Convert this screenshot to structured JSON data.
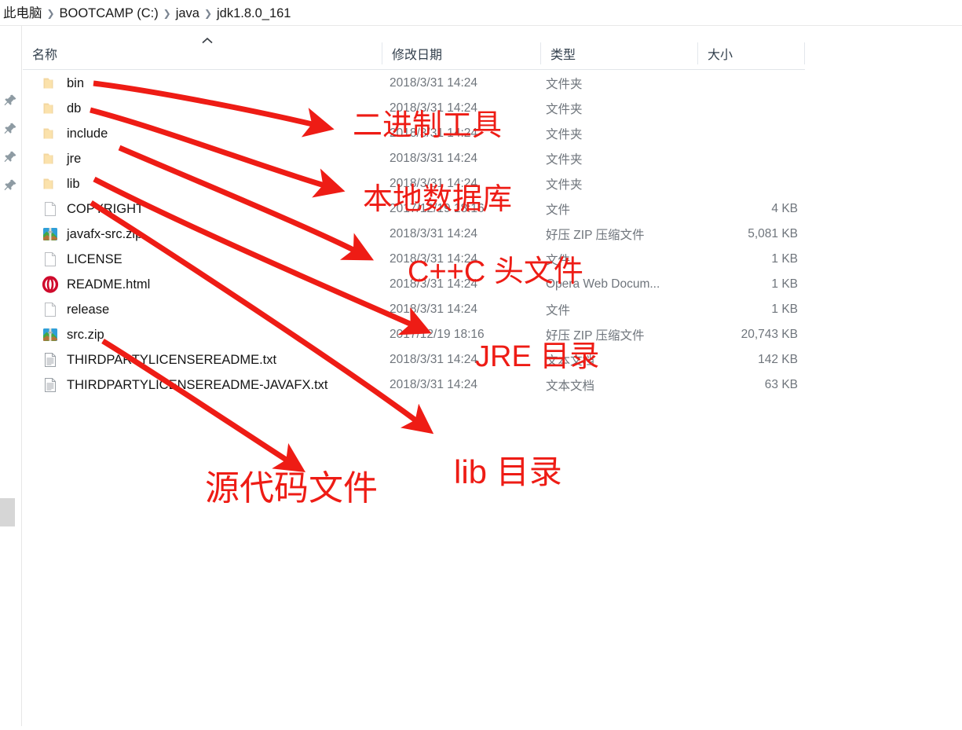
{
  "breadcrumb": {
    "separator": "❯",
    "items": [
      "此电脑",
      "BOOTCAMP (C:)",
      "java",
      "jdk1.8.0_161"
    ]
  },
  "nav_rail": {
    "pin_icon": "pin-icon",
    "pin_count": 4,
    "scrollbar": "vertical-scrollbar-thumb"
  },
  "columns": {
    "name": "名称",
    "date": "修改日期",
    "type": "类型",
    "size": "大小",
    "sort_indicator": "chevron-up-icon"
  },
  "files": [
    {
      "name": "bin",
      "icon": "folder-icon",
      "date": "2018/3/31 14:24",
      "type": "文件夹",
      "size": ""
    },
    {
      "name": "db",
      "icon": "folder-icon",
      "date": "2018/3/31 14:24",
      "type": "文件夹",
      "size": ""
    },
    {
      "name": "include",
      "icon": "folder-icon",
      "date": "2018/3/31 14:24",
      "type": "文件夹",
      "size": ""
    },
    {
      "name": "jre",
      "icon": "folder-icon",
      "date": "2018/3/31 14:24",
      "type": "文件夹",
      "size": ""
    },
    {
      "name": "lib",
      "icon": "folder-icon",
      "date": "2018/3/31 14:24",
      "type": "文件夹",
      "size": ""
    },
    {
      "name": "COPYRIGHT",
      "icon": "blank-file-icon",
      "date": "2017/12/19 18:16",
      "type": "文件",
      "size": "4 KB"
    },
    {
      "name": "javafx-src.zip",
      "icon": "zip-icon",
      "date": "2018/3/31 14:24",
      "type": "好压 ZIP 压缩文件",
      "size": "5,081 KB"
    },
    {
      "name": "LICENSE",
      "icon": "blank-file-icon",
      "date": "2018/3/31 14:24",
      "type": "文件",
      "size": "1 KB"
    },
    {
      "name": "README.html",
      "icon": "opera-icon",
      "date": "2018/3/31 14:24",
      "type": "Opera Web Docum...",
      "size": "1 KB"
    },
    {
      "name": "release",
      "icon": "blank-file-icon",
      "date": "2018/3/31 14:24",
      "type": "文件",
      "size": "1 KB"
    },
    {
      "name": "src.zip",
      "icon": "zip-icon",
      "date": "2017/12/19 18:16",
      "type": "好压 ZIP 压缩文件",
      "size": "20,743 KB"
    },
    {
      "name": "THIRDPARTYLICENSEREADME.txt",
      "icon": "text-file-icon",
      "date": "2018/3/31 14:24",
      "type": "文本文档",
      "size": "142 KB"
    },
    {
      "name": "THIRDPARTYLICENSEREADME-JAVAFX.txt",
      "icon": "text-file-icon",
      "date": "2018/3/31 14:24",
      "type": "文本文档",
      "size": "63 KB"
    }
  ],
  "annotations": {
    "color": "#ee1c15",
    "labels": [
      {
        "text": "二进制工具",
        "target": "bin"
      },
      {
        "text": "本地数据库",
        "target": "db"
      },
      {
        "text": "C++C 头文件",
        "target": "include"
      },
      {
        "text": "JRE 目录",
        "target": "jre"
      },
      {
        "text": "lib 目录",
        "target": "lib"
      },
      {
        "text": "源代码文件",
        "target": "src.zip"
      }
    ],
    "arrow_count": 6
  }
}
